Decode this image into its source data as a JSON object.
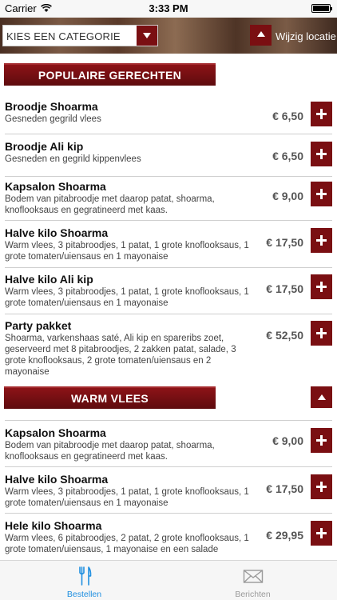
{
  "status_bar": {
    "carrier": "Carrier",
    "time": "3:33 PM"
  },
  "header": {
    "category_select": {
      "value": "KIES EEN CATEGORIE"
    },
    "location_button": {
      "label": "Wijzig locatie"
    }
  },
  "sections": [
    {
      "title": "POPULAIRE GERECHTEN",
      "items": [
        {
          "name": "Broodje Shoarma",
          "desc": "Gesneden gegrild vlees",
          "price": "€ 6,50"
        },
        {
          "name": "Broodje Ali kip",
          "desc": "Gesneden en gegrild kippenvlees",
          "price": "€ 6,50"
        },
        {
          "name": "Kapsalon Shoarma",
          "desc": "Bodem van pitabroodje met daarop patat, shoarma, knoflooksaus en gegratineerd met kaas.",
          "price": "€ 9,00"
        },
        {
          "name": "Halve kilo Shoarma",
          "desc": "Warm vlees, 3 pitabroodjes, 1 patat, 1 grote knoflooksaus, 1 grote tomaten/uiensaus en 1 mayonaise",
          "price": "€ 17,50"
        },
        {
          "name": "Halve kilo Ali kip",
          "desc": "Warm vlees, 3 pitabroodjes, 1 patat, 1 grote knoflooksaus, 1 grote tomaten/uiensaus en 1 mayonaise",
          "price": "€ 17,50"
        },
        {
          "name": "Party pakket",
          "desc": "Shoarma, varkenshaas saté, Ali kip en spareribs zoet, geserveerd met 8 pitabroodjes, 2 zakken patat, salade, 3 grote knoflooksaus, 2 grote tomaten/uiensaus en 2 mayonaise",
          "price": "€ 52,50"
        }
      ]
    },
    {
      "title": "WARM VLEES",
      "items": [
        {
          "name": "Kapsalon Shoarma",
          "desc": "Bodem van pitabroodje met daarop patat, shoarma, knoflooksaus en gegratineerd met kaas.",
          "price": "€ 9,00"
        },
        {
          "name": "Halve kilo Shoarma",
          "desc": "Warm vlees, 3 pitabroodjes, 1 patat, 1 grote knoflooksaus, 1 grote tomaten/uiensaus en 1 mayonaise",
          "price": "€ 17,50"
        },
        {
          "name": "Hele kilo Shoarma",
          "desc": "Warm vlees, 6 pitabroodjes, 2 patat, 2 grote knoflooksaus, 1 grote tomaten/uiensaus, 1 mayonaise en een salade",
          "price": "€ 29,95"
        }
      ]
    }
  ],
  "tab_bar": {
    "tabs": [
      {
        "label": "Bestellen",
        "icon": "fork-knife-icon",
        "active": true
      },
      {
        "label": "Berichten",
        "icon": "envelope-icon",
        "active": false
      }
    ]
  },
  "colors": {
    "accent": "#7a0f12",
    "active_tab": "#1f8fe0",
    "inactive_tab": "#9a9a9a"
  }
}
